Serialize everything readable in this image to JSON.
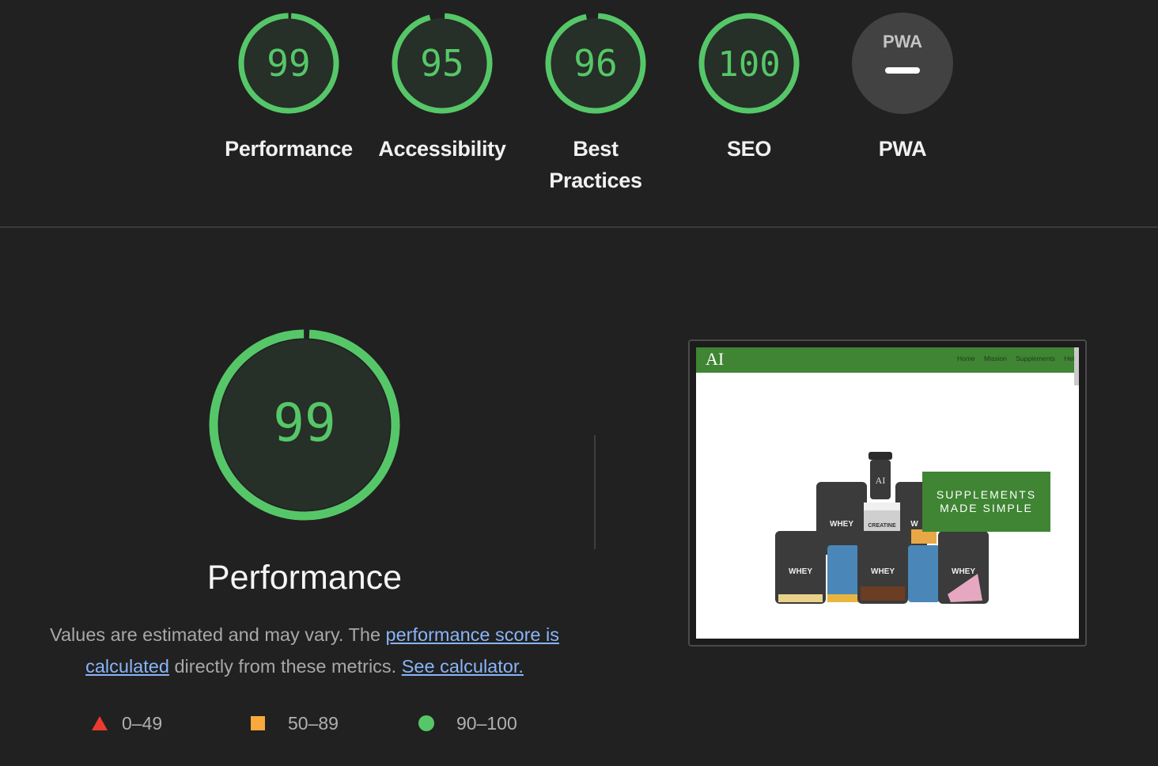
{
  "categories": [
    {
      "label": "Performance",
      "score": "99",
      "value": 99
    },
    {
      "label": "Accessibility",
      "score": "95",
      "value": 95
    },
    {
      "label": "Best Practices",
      "score": "96",
      "value": 96
    },
    {
      "label": "SEO",
      "score": "100",
      "value": 100
    },
    {
      "label": "PWA",
      "badge": "PWA",
      "status": "not-applicable"
    }
  ],
  "detail": {
    "score": "99",
    "value": 99,
    "title": "Performance",
    "desc_prefix": "Values are estimated and may vary. The ",
    "desc_link1": "performance score is calculated",
    "desc_middle": " directly from these metrics. ",
    "desc_link2": "See calculator."
  },
  "legend": [
    {
      "label": "0–49",
      "shape": "triangle",
      "color": "#eb3b2f"
    },
    {
      "label": "50–89",
      "shape": "square",
      "color": "#f7a93b"
    },
    {
      "label": "90–100",
      "shape": "circle",
      "color": "#56c768"
    }
  ],
  "colors": {
    "pass": "#56c768",
    "pass_bg": "#262f28",
    "background": "#212121",
    "link": "#8ab4f8",
    "site_green": "#3f8533"
  },
  "screenshot": {
    "logo": "AI",
    "nav": [
      "Home",
      "Mission",
      "Supplements",
      "Hel"
    ],
    "banner_line1": "SUPPLEMENTS",
    "banner_line2": "MADE SIMPLE",
    "products": [
      "WHEY",
      "CREATINE",
      "W",
      "WHEY",
      "WHEY",
      "WHEY"
    ]
  }
}
